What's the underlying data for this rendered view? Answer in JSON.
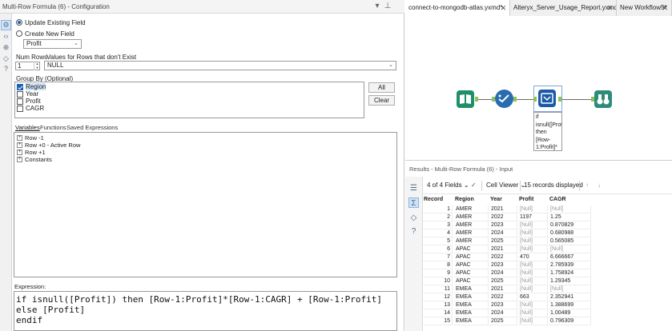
{
  "config": {
    "title": "Multi-Row Formula (6) - Configuration",
    "update_existing_label": "Update Existing Field",
    "create_new_label": "Create New  Field",
    "field_selected": "Profit",
    "num_rows_label": "Num Rows",
    "num_rows_value": "1",
    "values_label": "Values for Rows that don't Exist",
    "values_selected": "NULL",
    "group_by_label": "Group By (Optional)",
    "group_by_items": [
      {
        "label": "Region",
        "checked": true
      },
      {
        "label": "Year",
        "checked": false
      },
      {
        "label": "Profit",
        "checked": false
      },
      {
        "label": "CAGR",
        "checked": false
      }
    ],
    "all_button": "All",
    "clear_button": "Clear",
    "tabs": [
      "Variables",
      "Functions",
      "Saved Expressions"
    ],
    "tree_items": [
      "Row -1",
      "Row +0 - Active Row",
      "Row +1",
      "Constants"
    ],
    "expression_label": "Expression:",
    "expression": "if isnull([Profit]) then [Row-1:Profit]*[Row-1:CAGR] + [Row-1:Profit] else [Profit]\nendif"
  },
  "doc_tabs": [
    {
      "label": "connect-to-mongodb-atlas.yxmd*",
      "active": true
    },
    {
      "label": "Alteryx_Server_Usage_Report.yxmd",
      "active": false
    },
    {
      "label": "New Workflow5*",
      "active": false
    }
  ],
  "canvas": {
    "annotation": "if isnull([Profit]) then [Row-1:Profit]*[Row-1:CAGR] + [Row -1..."
  },
  "results": {
    "title": "Results - Multi-Row Formula (6) - Input",
    "fields_label": "4 of 4 Fields",
    "cell_viewer_label": "Cell Viewer",
    "records_label": "15 records displayed",
    "columns": [
      "Record",
      "Region",
      "Year",
      "Profit",
      "CAGR"
    ],
    "rows": [
      [
        "1",
        "AMER",
        "2021",
        "[Null]",
        "[Null]"
      ],
      [
        "2",
        "AMER",
        "2022",
        "1197",
        "1.25"
      ],
      [
        "3",
        "AMER",
        "2023",
        "[Null]",
        "0.870829"
      ],
      [
        "4",
        "AMER",
        "2024",
        "[Null]",
        "0.680988"
      ],
      [
        "5",
        "AMER",
        "2025",
        "[Null]",
        "0.565085"
      ],
      [
        "6",
        "APAC",
        "2021",
        "[Null]",
        "[Null]"
      ],
      [
        "7",
        "APAC",
        "2022",
        "470",
        "6.666667"
      ],
      [
        "8",
        "APAC",
        "2023",
        "[Null]",
        "2.785939"
      ],
      [
        "9",
        "APAC",
        "2024",
        "[Null]",
        "1.758924"
      ],
      [
        "10",
        "APAC",
        "2025",
        "[Null]",
        "1.29345"
      ],
      [
        "11",
        "EMEA",
        "2021",
        "[Null]",
        "[Null]"
      ],
      [
        "12",
        "EMEA",
        "2022",
        "663",
        "2.352941"
      ],
      [
        "13",
        "EMEA",
        "2023",
        "[Null]",
        "1.388699"
      ],
      [
        "14",
        "EMEA",
        "2024",
        "[Null]",
        "1.00489"
      ],
      [
        "15",
        "EMEA",
        "2025",
        "[Null]",
        "0.796309"
      ]
    ]
  },
  "colors": {
    "accent": "#1a60b5",
    "tool_input": "#1f8f6a",
    "tool_select": "#2a6cb0",
    "tool_multirow": "#1b5aa6",
    "tool_browse": "#2d8b7a",
    "anchor": "#8fc25b"
  }
}
